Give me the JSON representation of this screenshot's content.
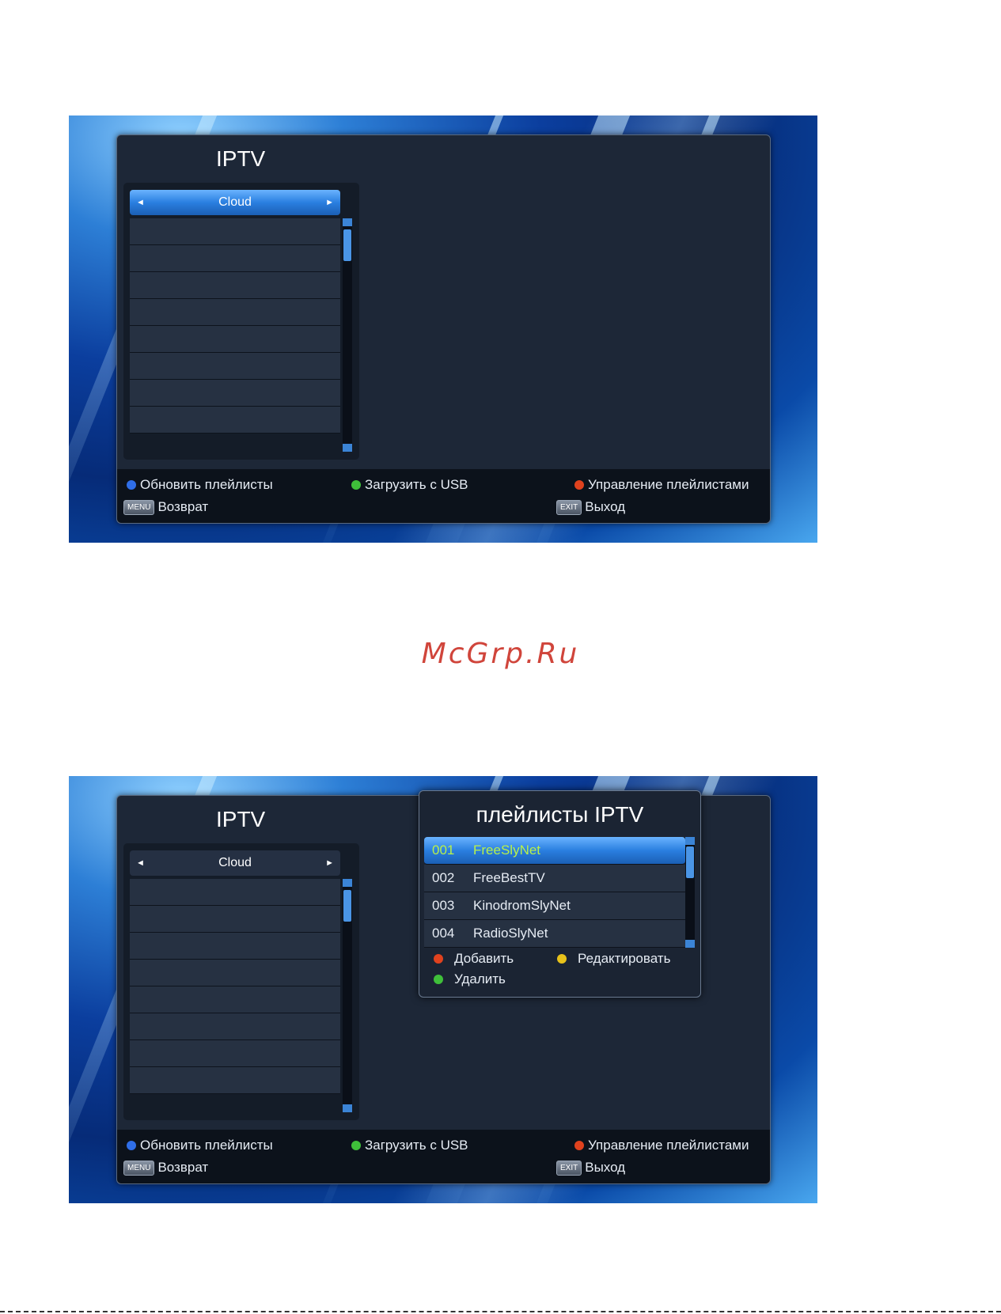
{
  "watermark": "McGrp.Ru",
  "colors": {
    "blue_key": "#2f6ee8",
    "green_key": "#3fbf3a",
    "red_key": "#e0421e",
    "yellow_key": "#e8c21a",
    "selected_text": "#b8f04a"
  },
  "screen1": {
    "title": "IPTV",
    "source_selector": "Cloud",
    "footer": {
      "refresh": "Обновить плейлисты",
      "usb": "Загрузить с USB",
      "manage": "Управление плейлистами",
      "menu_key": "MENU",
      "back": "Возврат",
      "exit_key": "EXIT",
      "exit": "Выход"
    }
  },
  "screen2": {
    "title": "IPTV",
    "source_selector": "Cloud",
    "popup": {
      "title": "плейлисты IPTV",
      "playlists": [
        {
          "num": "001",
          "name": "FreeSlyNet"
        },
        {
          "num": "002",
          "name": "FreeBestTV"
        },
        {
          "num": "003",
          "name": "KinodromSlyNet"
        },
        {
          "num": "004",
          "name": "RadioSlyNet"
        }
      ],
      "add": "Добавить",
      "edit": "Редактировать",
      "delete": "Удалить"
    },
    "footer": {
      "refresh": "Обновить плейлисты",
      "usb": "Загрузить с USB",
      "manage": "Управление плейлистами",
      "menu_key": "MENU",
      "back": "Возврат",
      "exit_key": "EXIT",
      "exit": "Выход"
    }
  }
}
